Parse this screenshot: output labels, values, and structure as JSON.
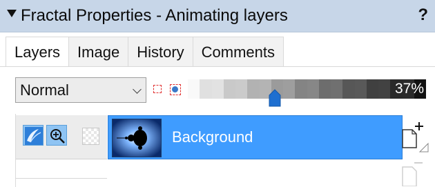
{
  "window": {
    "title": "Fractal Properties - Animating layers",
    "help_label": "?"
  },
  "tabs": [
    {
      "label": "Layers",
      "active": true
    },
    {
      "label": "Image",
      "active": false
    },
    {
      "label": "History",
      "active": false
    },
    {
      "label": "Comments",
      "active": false
    }
  ],
  "blend_mode": {
    "value": "Normal"
  },
  "opacity": {
    "label": "37%",
    "value": 0.37
  },
  "layers": [
    {
      "name": "Background",
      "selected": true
    }
  ],
  "colors": {
    "titlebar": "#c7d6e8",
    "selection": "#3f9cff",
    "accent": "#1e6fd0"
  },
  "icons": {
    "collapse": "triangle-down-icon",
    "help": "question-mark-icon",
    "mask_rect": "rectangle-mask-icon",
    "mask_circle": "circle-mask-icon",
    "layer_mode": "layer-mode-icon",
    "zoom": "zoom-in-icon",
    "transparency": "checkerboard-icon",
    "new_layer": "new-layer-icon",
    "delete_layer": "delete-layer-icon"
  }
}
